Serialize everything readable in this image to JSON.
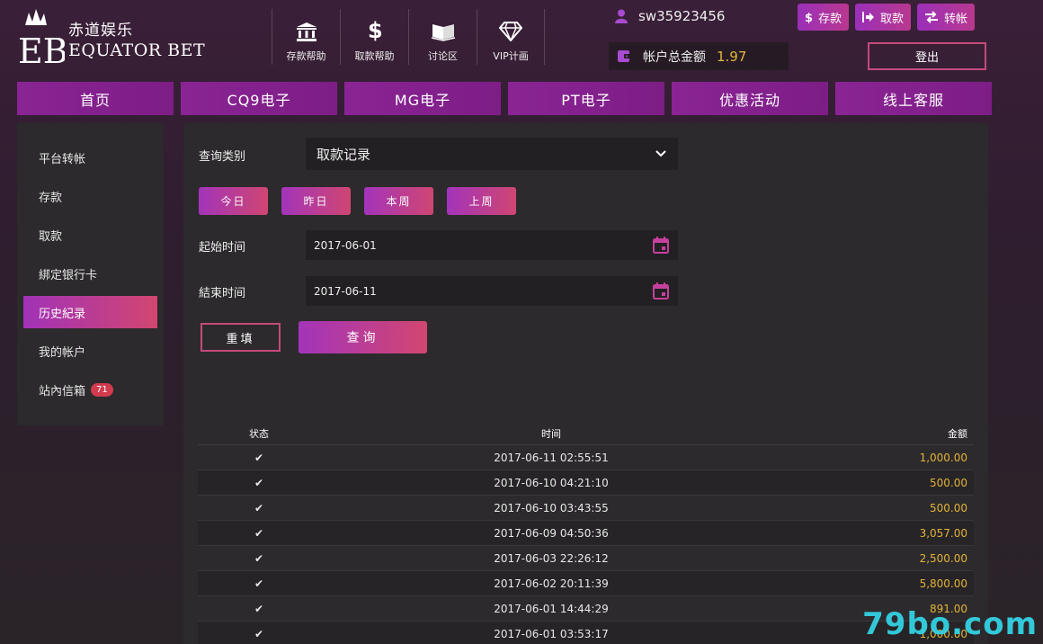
{
  "brand": {
    "name_cn": "赤道娱乐",
    "name_en": "EQUATOR BET",
    "mark": "EB"
  },
  "topnav": [
    {
      "label": "存款帮助",
      "icon": "bank-icon"
    },
    {
      "label": "取款帮助",
      "icon": "dollar-icon"
    },
    {
      "label": "讨论区",
      "icon": "book-icon"
    },
    {
      "label": "VIP计画",
      "icon": "diamond-icon"
    }
  ],
  "user": {
    "username": "sw35923456"
  },
  "account_buttons": {
    "deposit": "存款",
    "withdraw": "取款",
    "transfer": "转帐"
  },
  "balance": {
    "label": "帐户总金额",
    "value": "1.97"
  },
  "logout_label": "登出",
  "mainnav": [
    "首页",
    "CQ9电子",
    "MG电子",
    "PT电子",
    "优惠活动",
    "线上客服"
  ],
  "sidebar": {
    "items": [
      {
        "label": "平台转帐"
      },
      {
        "label": "存款"
      },
      {
        "label": "取款"
      },
      {
        "label": "綁定银行卡"
      },
      {
        "label": "历史紀录"
      },
      {
        "label": "我的帐户"
      },
      {
        "label": "站內信箱"
      }
    ],
    "active_index": 4,
    "inbox_count": "71"
  },
  "query": {
    "type_label": "查询类别",
    "type_value": "取款记录",
    "quick": [
      "今日",
      "昨日",
      "本周",
      "上周"
    ],
    "start_label": "起始时间",
    "start_value": "2017-06-01",
    "end_label": "結束时间",
    "end_value": "2017-06-11",
    "reset_label": "重填",
    "submit_label": "查询"
  },
  "table": {
    "headers": {
      "status": "状态",
      "time": "时间",
      "amount": "金额"
    },
    "rows": [
      {
        "status": "✔",
        "time": "2017-06-11 02:55:51",
        "amount": "1,000.00"
      },
      {
        "status": "✔",
        "time": "2017-06-10 04:21:10",
        "amount": "500.00"
      },
      {
        "status": "✔",
        "time": "2017-06-10 03:43:55",
        "amount": "500.00"
      },
      {
        "status": "✔",
        "time": "2017-06-09 04:50:36",
        "amount": "3,057.00"
      },
      {
        "status": "✔",
        "time": "2017-06-03 22:26:12",
        "amount": "2,500.00"
      },
      {
        "status": "✔",
        "time": "2017-06-02 20:11:39",
        "amount": "5,800.00"
      },
      {
        "status": "✔",
        "time": "2017-06-01 14:44:29",
        "amount": "891.00"
      },
      {
        "status": "✔",
        "time": "2017-06-01 03:53:17",
        "amount": "1,000.00"
      }
    ]
  },
  "watermark": "79bo.com",
  "colors": {
    "accent": "#a334ba",
    "accent2": "#d24670",
    "gold": "#e2b23a"
  }
}
